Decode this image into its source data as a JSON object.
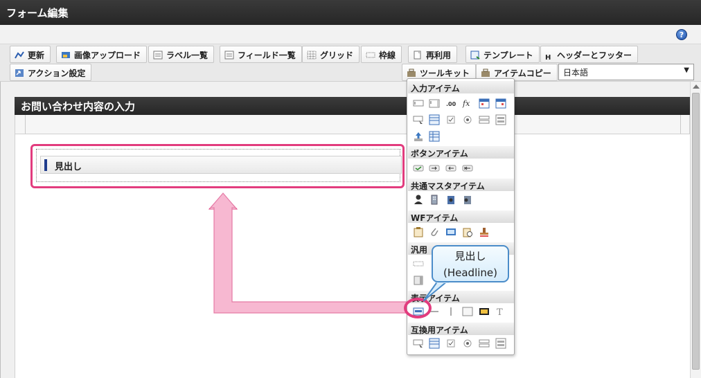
{
  "window": {
    "title": "フォーム編集",
    "help_label": "?"
  },
  "toolbar": {
    "row1": [
      {
        "label": "更新",
        "icon": "update-icon"
      },
      {
        "label": "画像アップロード",
        "icon": "image-upload-icon"
      },
      {
        "label": "ラベル一覧",
        "icon": "label-list-icon"
      },
      {
        "label": "フィールド一覧",
        "icon": "field-list-icon"
      },
      {
        "label": "グリッド",
        "icon": "grid-icon"
      },
      {
        "label": "枠線",
        "icon": "border-icon"
      },
      {
        "label": "再利用",
        "icon": "reuse-icon"
      },
      {
        "label": "テンプレート",
        "icon": "template-icon"
      },
      {
        "label": "ヘッダーとフッター",
        "icon": "header-footer-icon"
      }
    ],
    "row2": [
      {
        "label": "アクション設定",
        "icon": "action-icon"
      },
      {
        "label": "ツールキット",
        "icon": "toolkit-icon"
      },
      {
        "label": "アイテムコピー",
        "icon": "item-copy-icon"
      }
    ],
    "language": "日本語"
  },
  "form": {
    "title": "お問い合わせ内容の入力",
    "headline_label": "見出し"
  },
  "palette": {
    "sections": [
      {
        "title": "入力アイテム"
      },
      {
        "title": "ボタンアイテム"
      },
      {
        "title": "共通マスタアイテム"
      },
      {
        "title": "WFアイテム"
      },
      {
        "title": "汎用"
      },
      {
        "title": "表示アイテム"
      },
      {
        "title": "互換用アイテム"
      }
    ]
  },
  "callout": {
    "line1": "見出し",
    "line2": "(Headline)"
  },
  "colors": {
    "highlight": "#e23c7e",
    "callout_border": "#4a8cc9",
    "arrow": "#f7b8d1"
  }
}
